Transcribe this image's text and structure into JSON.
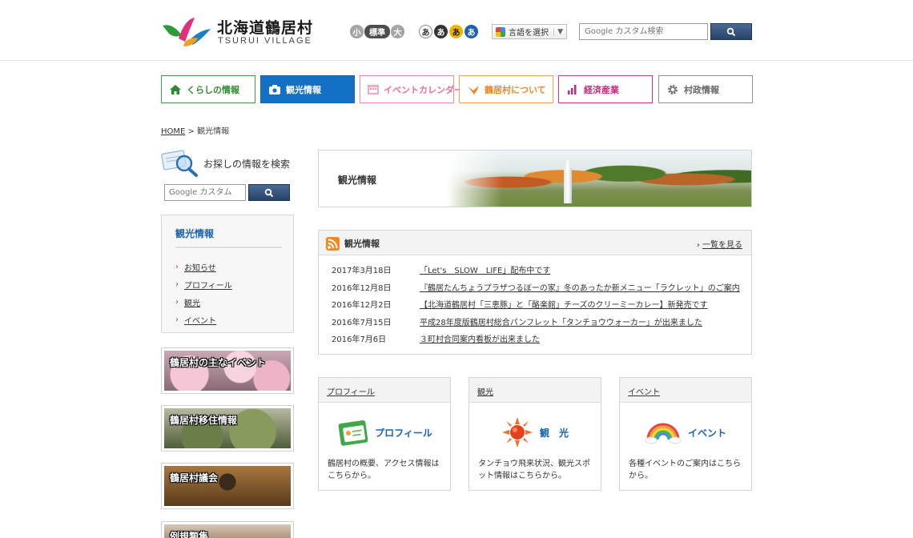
{
  "header": {
    "logo_jp": "北海道鶴居村",
    "logo_en": "TSURUI VILLAGE",
    "font_size": {
      "small": "小",
      "medium": "標準",
      "large": "大"
    },
    "color_options": [
      "あ",
      "あ",
      "あ",
      "あ"
    ],
    "language_label": "言語を選択",
    "language_arrow": "▼",
    "search_placeholder": "Google カスタム検索"
  },
  "nav": {
    "items": [
      {
        "label": "くらしの情報"
      },
      {
        "label": "観光情報"
      },
      {
        "label": "イベントカレンダー"
      },
      {
        "label": "鶴居村について"
      },
      {
        "label": "経済産業"
      },
      {
        "label": "村政情報"
      }
    ]
  },
  "breadcrumb": {
    "home": "HOME",
    "separator": ">",
    "current": "観光情報"
  },
  "sidebar": {
    "search_title": "お探しの情報を検索",
    "search_placeholder": "Google カスタム",
    "menu_title": "観光情報",
    "menu_items": [
      "お知らせ",
      "プロフィール",
      "観光",
      "イベント"
    ],
    "banners": [
      "鶴居村の主なイベント",
      "鶴居村移住情報",
      "鶴居村議会",
      "例規類集"
    ]
  },
  "hero": {
    "title": "観光情報"
  },
  "news": {
    "title": "観光情報",
    "more": "一覧を見る",
    "items": [
      {
        "date": "2017年3月18日",
        "text": "「Let's　SLOW　LIFE」配布中です"
      },
      {
        "date": "2016年12月8日",
        "text": "『鶴居たんちょうプラザつるぼーの家』冬のあったか新メニュー「ラクレット」のご案内"
      },
      {
        "date": "2016年12月2日",
        "text": "【北海道鶴居村「三恵豚」と「酪楽館」チーズのクリーミーカレー】新発売です"
      },
      {
        "date": "2016年7月15日",
        "text": "平成28年度版鶴居村総合パンフレット「タンチョウウォーカー」が出来ました"
      },
      {
        "date": "2016年7月6日",
        "text": "３町村合同案内看板が出来ました"
      }
    ]
  },
  "cards": [
    {
      "head": "プロフィール",
      "label": "プロフィール",
      "desc": "鶴居村の概要、アクセス情報はこちらから。"
    },
    {
      "head": "観光",
      "label": "観　光",
      "desc": "タンチョウ飛来状況、観光スポット情報はこちらから。"
    },
    {
      "head": "イベント",
      "label": "イベント",
      "desc": "各種イベントのご案内はこちらから。"
    }
  ],
  "colors": {
    "accent_blue": "#1470c4",
    "link_blue": "#1b63b0",
    "bullet_red": "#c0392b",
    "rss_orange": "#f08a24"
  }
}
